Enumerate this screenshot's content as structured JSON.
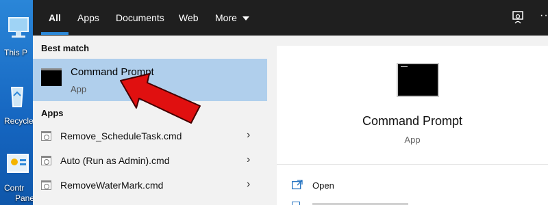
{
  "desktop": {
    "icons": [
      {
        "icon": "this-pc-icon",
        "label": "This P"
      },
      {
        "icon": "recycle-bin-icon",
        "label": "Recycle"
      },
      {
        "icon": "control-panel-icon",
        "label": "Contr"
      },
      {
        "icon": "control-panel-icon-line2",
        "label": "Pane"
      }
    ]
  },
  "tabs": {
    "all": "All",
    "apps": "Apps",
    "documents": "Documents",
    "web": "Web",
    "more": "More",
    "more_icon": "caret-down-icon"
  },
  "toolbar": {
    "feedback_icon": "feedback-icon",
    "more_options": "···"
  },
  "best_match": {
    "heading": "Best match",
    "title": "Command Prompt",
    "type": "App"
  },
  "apps": {
    "heading": "Apps",
    "items": [
      {
        "name": "Remove_ScheduleTask.cmd"
      },
      {
        "name": "Auto (Run as Admin).cmd"
      },
      {
        "name": "RemoveWaterMark.cmd"
      }
    ]
  },
  "preview": {
    "title": "Command Prompt",
    "subtitle": "App",
    "actions": [
      {
        "label": "Open",
        "icon": "open-icon"
      }
    ]
  },
  "colors": {
    "topbar": "#1f1f1f",
    "accent": "#2b88d8",
    "selection": "#b0cfec",
    "annotation_arrow": "#e01010"
  }
}
